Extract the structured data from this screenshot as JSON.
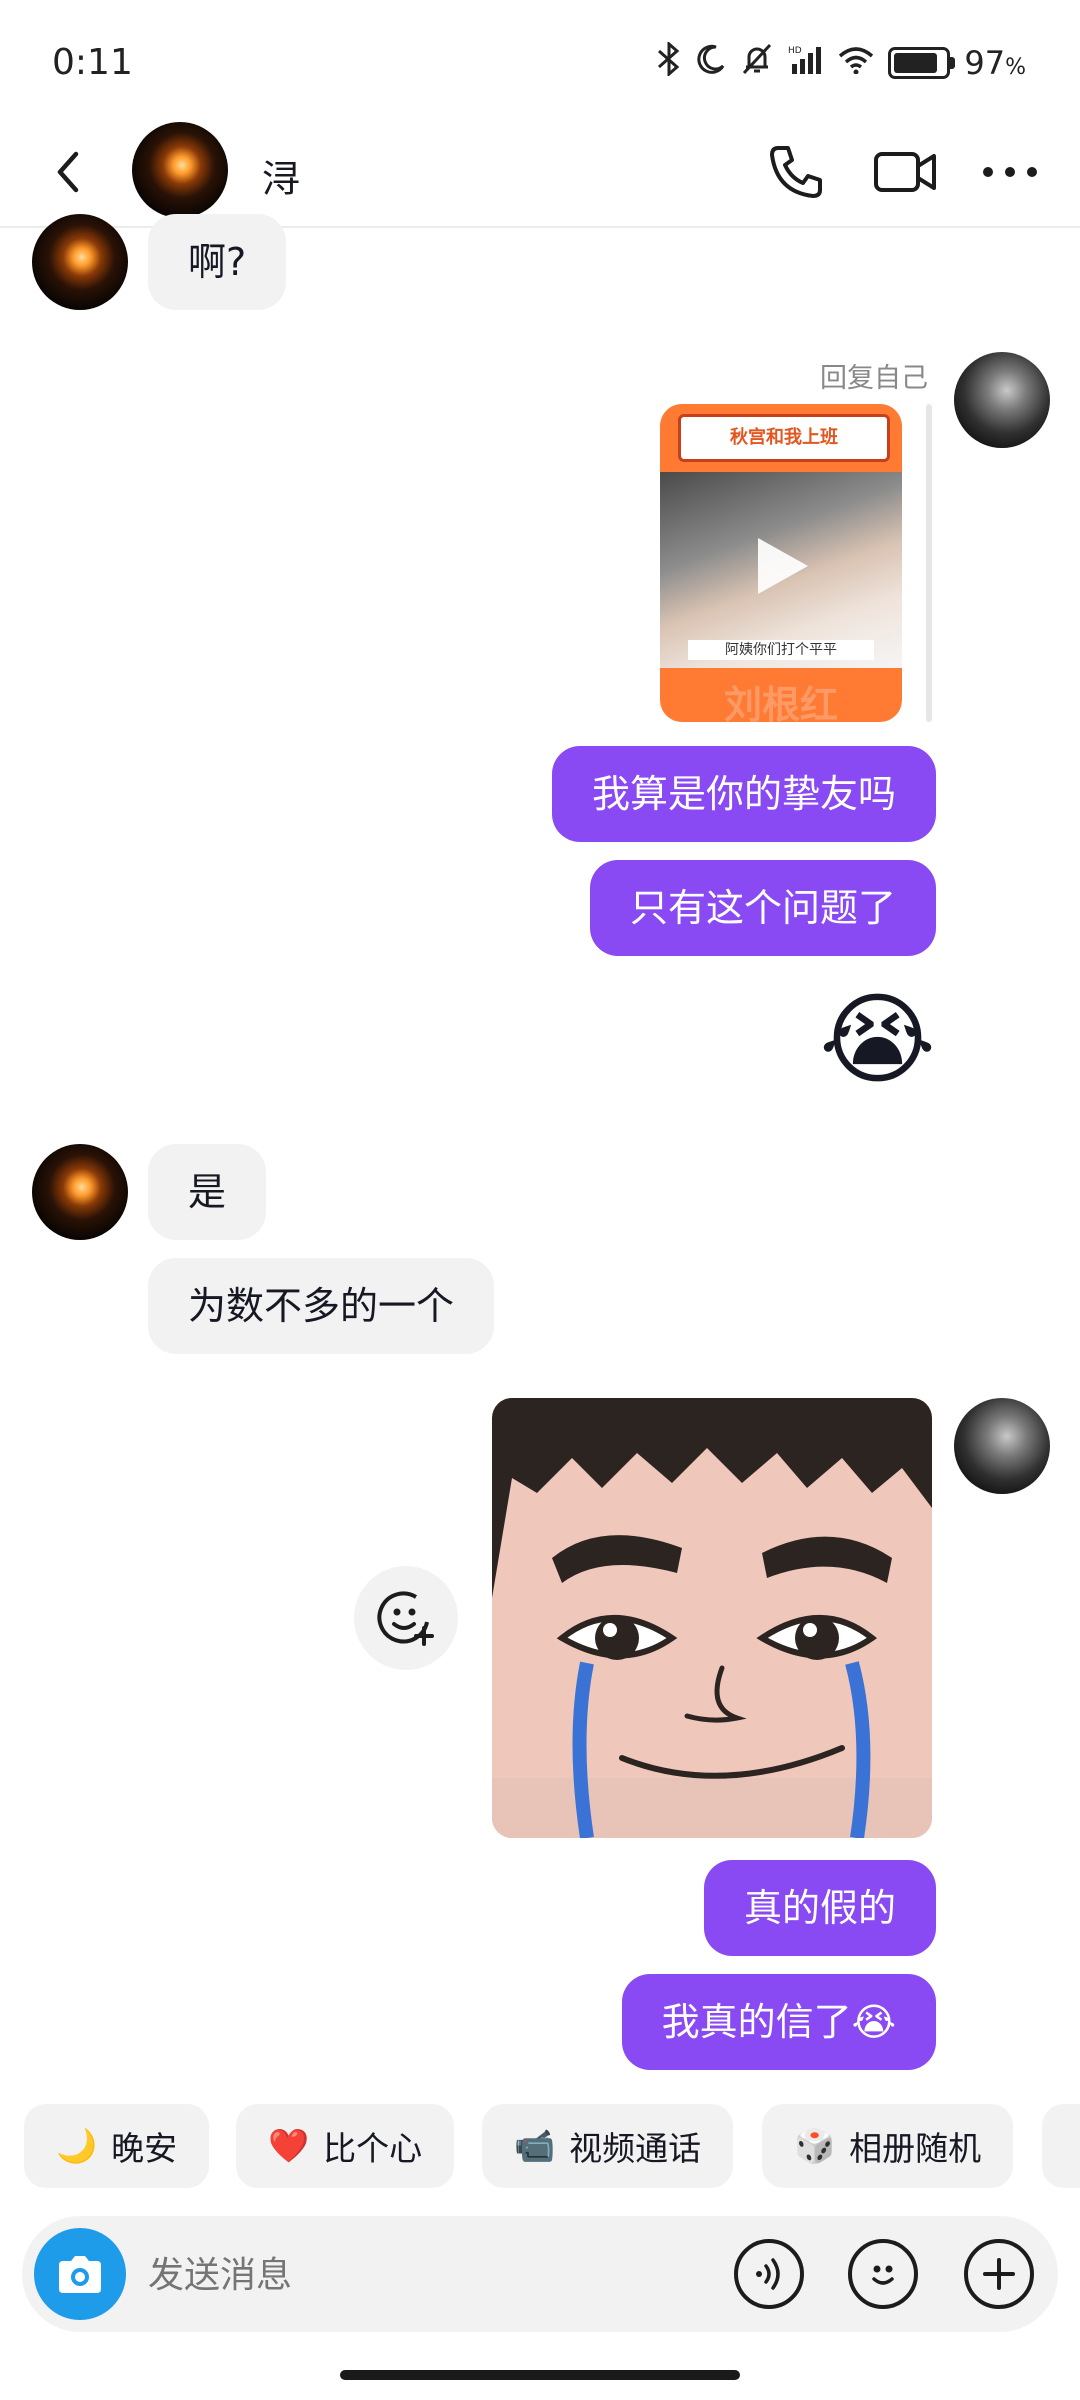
{
  "status_bar": {
    "time": "0:11",
    "battery": "97",
    "battery_unit": "%",
    "battery_level": 0.97
  },
  "header": {
    "contact_name": "浔"
  },
  "messages": {
    "m1": "啊?",
    "reply_hint": "回复自己",
    "video_banner": "秋宫和我上班",
    "video_subtitle": "阿姨你们打个平平",
    "video_watermark": "刘根红",
    "m2": "我算是你的挚友吗",
    "m3": "只有这个问题了",
    "m4": "😭",
    "m5": "是",
    "m6": "为数不多的一个",
    "m7": "真的假的",
    "m8": "我真的信了😭"
  },
  "quick_replies": [
    {
      "emoji": "🌙",
      "label": "晚安"
    },
    {
      "emoji": "❤️",
      "label": "比个心"
    },
    {
      "emoji": "📹",
      "label": "视频通话"
    },
    {
      "emoji": "🎲",
      "label": "相册随机"
    }
  ],
  "input": {
    "placeholder": "发送消息"
  },
  "colors": {
    "bubble_outgoing": "#8a4af3",
    "bubble_incoming": "#f2f2f2",
    "camera_button": "#1e9be9"
  },
  "icons": [
    "bluetooth-icon",
    "moon-icon",
    "mute-icon",
    "signal-icon",
    "wifi-icon",
    "battery-icon",
    "back-icon",
    "phone-icon",
    "video-call-icon",
    "more-icon",
    "play-icon",
    "add-sticker-icon",
    "camera-icon",
    "voice-icon",
    "emoji-icon",
    "plus-icon"
  ]
}
